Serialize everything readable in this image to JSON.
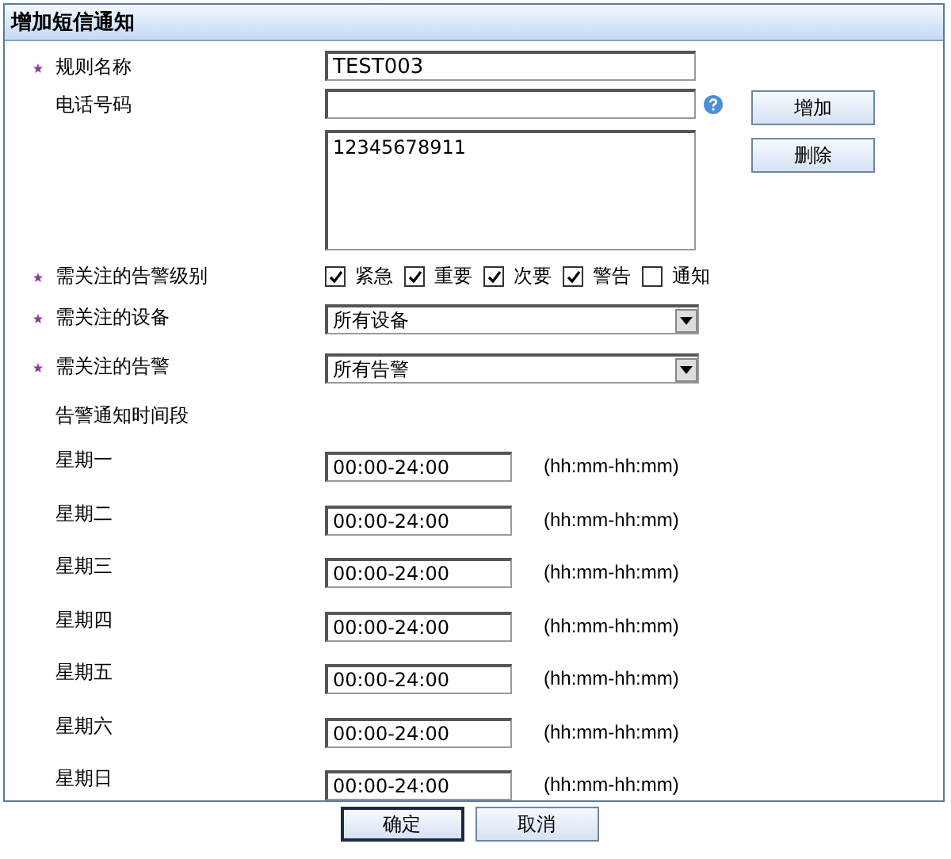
{
  "panel": {
    "title": "增加短信通知"
  },
  "rule_name": {
    "label": "规则名称",
    "required": true,
    "value": "TEST003"
  },
  "phone": {
    "label": "电话号码",
    "required": false,
    "list": "12345678911",
    "buttons": [
      "增加",
      "删除"
    ]
  },
  "alarm_levels": {
    "label": "需关注的告警级别",
    "required": true,
    "options": [
      {
        "label": "紧急",
        "checked": true
      },
      {
        "label": "重要",
        "checked": true
      },
      {
        "label": "次要",
        "checked": true
      },
      {
        "label": "警告",
        "checked": true
      },
      {
        "label": "通知",
        "checked": false
      }
    ]
  },
  "device": {
    "label": "需关注的设备",
    "required": true,
    "value": "所有设备"
  },
  "alarm": {
    "label": "需关注的告警",
    "required": true,
    "value": "所有告警"
  },
  "time_section": {
    "label": "告警通知时间段",
    "days": [
      {
        "label": "星期一",
        "value": "00:00-24:00",
        "hint": "(hh:mm-hh:mm)"
      },
      {
        "label": "星期二",
        "value": "00:00-24:00",
        "hint": "(hh:mm-hh:mm)"
      },
      {
        "label": "星期三",
        "value": "00:00-24:00",
        "hint": "(hh:mm-hh:mm)"
      },
      {
        "label": "星期四",
        "value": "00:00-24:00",
        "hint": "(hh:mm-hh:mm)"
      },
      {
        "label": "星期五",
        "value": "00:00-24:00",
        "hint": "(hh:mm-hh:mm)"
      },
      {
        "label": "星期六",
        "value": "00:00-24:00",
        "hint": "(hh:mm-hh:mm)"
      },
      {
        "label": "星期日",
        "value": "00:00-24:00",
        "hint": "(hh:mm-hh:mm)"
      }
    ]
  },
  "buttons": [
    {
      "label": "确定",
      "default": true
    },
    {
      "label": "取消",
      "default": false
    }
  ]
}
